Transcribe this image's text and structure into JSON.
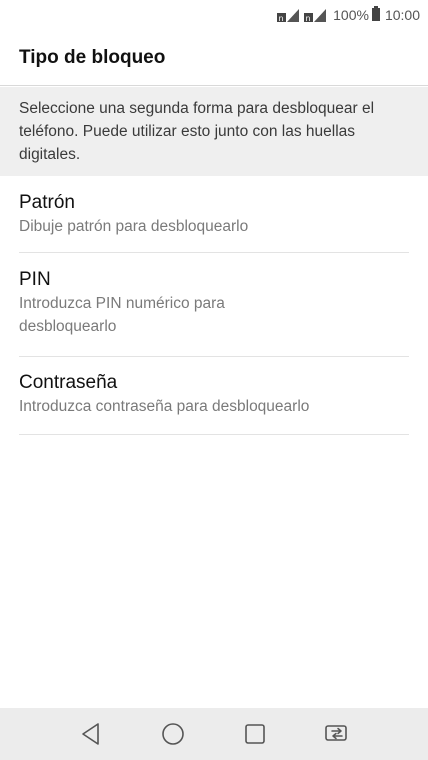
{
  "status_bar": {
    "battery_percent": "100%",
    "time": "10:00",
    "icons": [
      "signal-sim1-icon",
      "signal-sim2-icon",
      "battery-icon"
    ]
  },
  "app_bar": {
    "title": "Tipo de bloqueo"
  },
  "description": "Seleccione una segunda forma para desbloquear el teléfono. Puede utilizar esto junto con las huellas digitales.",
  "options": [
    {
      "title": "Patrón",
      "subtitle": "Dibuje patrón para desbloquearlo"
    },
    {
      "title": "PIN",
      "subtitle": "Introduzca PIN numérico para desbloquearlo"
    },
    {
      "title": "Contraseña",
      "subtitle": "Introduzca contraseña para desbloquearlo"
    }
  ],
  "nav_bar": {
    "icons": [
      "back-icon",
      "home-icon",
      "recent-apps-icon",
      "dual-window-icon"
    ]
  },
  "colors": {
    "description_bg": "#efefef",
    "nav_bg": "#ececec",
    "divider": "#e3e3e3",
    "title_text": "#111111",
    "subtitle_text": "#7a7a7a"
  }
}
